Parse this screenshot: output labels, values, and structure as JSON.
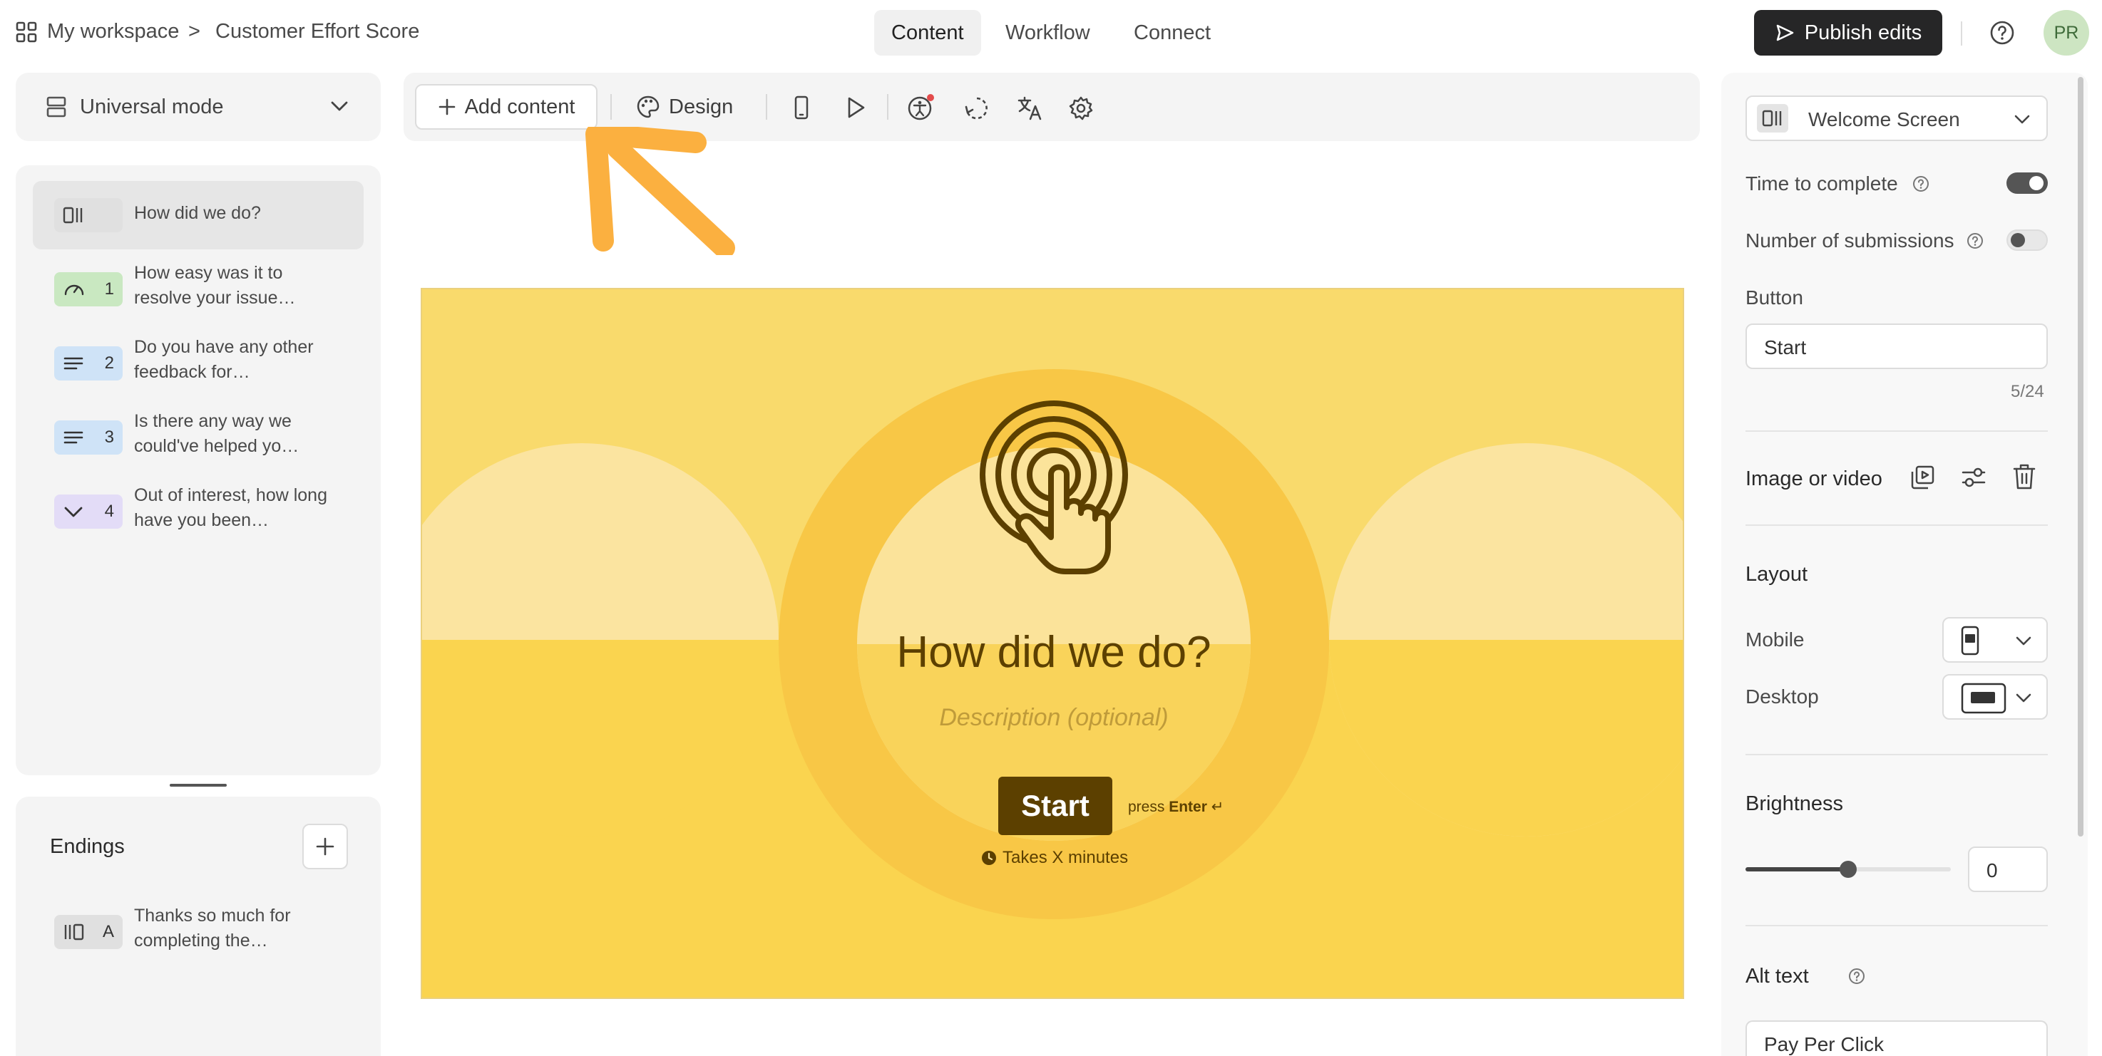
{
  "breadcrumb": {
    "workspace": "My workspace",
    "separator": ">",
    "form_title": "Customer Effort Score"
  },
  "nav_tabs": [
    {
      "label": "Content",
      "active": true
    },
    {
      "label": "Workflow",
      "active": false
    },
    {
      "label": "Connect",
      "active": false
    }
  ],
  "header": {
    "publish_label": "Publish edits",
    "avatar_initials": "PR",
    "help_icon": "help-circle-icon"
  },
  "left_panel": {
    "mode_label": "Universal mode",
    "questions": [
      {
        "badge": "",
        "icon": "welcome-screen-icon",
        "badge_color": "#e0e0e0",
        "text": "How did we do?",
        "selected": true
      },
      {
        "badge": "1",
        "icon": "gauge-icon",
        "badge_color": "#c9e8c1",
        "text": "How easy was it to resolve your issue…",
        "selected": false
      },
      {
        "badge": "2",
        "icon": "long-text-icon",
        "badge_color": "#cfe3f7",
        "text": "Do you have any other feedback for…",
        "selected": false
      },
      {
        "badge": "3",
        "icon": "long-text-icon",
        "badge_color": "#cfe3f7",
        "text": "Is there any way we could've helped yo…",
        "selected": false
      },
      {
        "badge": "4",
        "icon": "dropdown-icon",
        "badge_color": "#e3dcf7",
        "text": "Out of interest, how long have you been…",
        "selected": false
      }
    ],
    "endings_title": "Endings",
    "endings": [
      {
        "badge": "A",
        "icon": "ending-screen-icon",
        "text": "Thanks so much for completing the…"
      }
    ]
  },
  "toolbar": {
    "add_content_label": "Add content",
    "design_label": "Design"
  },
  "preview": {
    "title": "How did we do?",
    "description_placeholder": "Description (optional)",
    "button_label": "Start",
    "press_label": "press",
    "enter_label": "Enter",
    "enter_glyph": "↵",
    "time_label": "Takes X minutes"
  },
  "right_panel": {
    "screen_type": "Welcome Screen",
    "time_to_complete": {
      "label": "Time to complete",
      "on": true
    },
    "number_of_submissions": {
      "label": "Number of submissions",
      "on": false
    },
    "button_label_title": "Button",
    "button_value": "Start",
    "char_count": "5/24",
    "image_or_video": "Image or video",
    "layout_title": "Layout",
    "mobile_label": "Mobile",
    "desktop_label": "Desktop",
    "brightness_title": "Brightness",
    "brightness_value": "0",
    "alt_text_title": "Alt text",
    "alt_text_value": "Pay Per Click"
  },
  "colors": {
    "publish_bg": "#262627",
    "canvas_bg": "#f9d96a",
    "start_button_bg": "#5c4000",
    "preview_text": "#5c4000",
    "annotation_arrow": "#fbb040"
  }
}
